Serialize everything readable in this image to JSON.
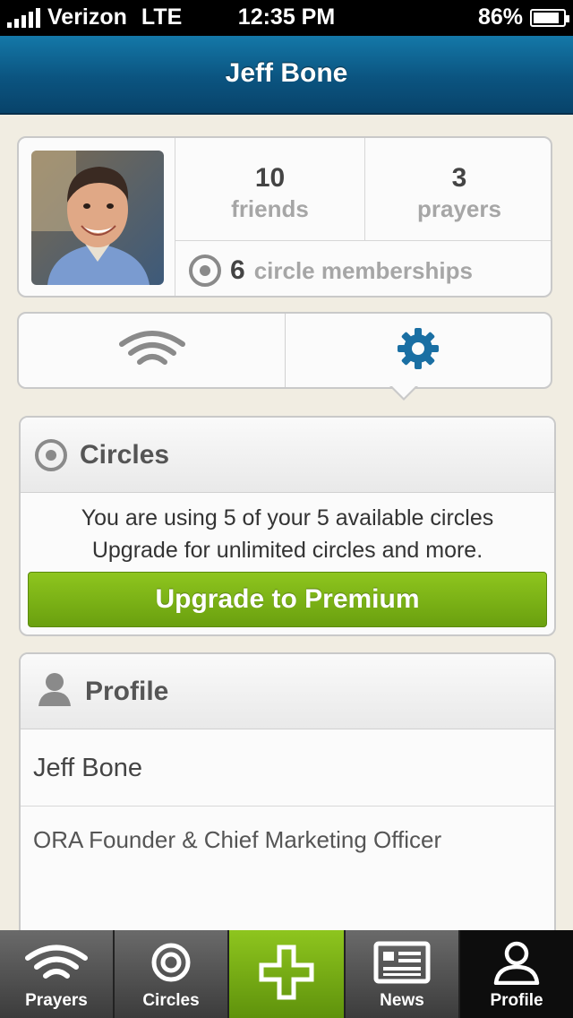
{
  "status_bar": {
    "carrier": "Verizon",
    "network": "LTE",
    "time": "12:35 PM",
    "battery": "86%"
  },
  "nav": {
    "title": "Jeff Bone"
  },
  "stats": {
    "friends_count": "10",
    "friends_label": "friends",
    "prayers_count": "3",
    "prayers_label": "prayers",
    "memberships_count": "6",
    "memberships_label": "circle memberships"
  },
  "segment": {
    "left_icon": "wifi-icon",
    "right_icon": "gear-icon",
    "selected": "settings"
  },
  "circles_panel": {
    "title": "Circles",
    "line1": "You are using 5 of your 5 available circles",
    "line2": "Upgrade for unlimited circles and more.",
    "button": "Upgrade to Premium"
  },
  "profile_panel": {
    "title": "Profile",
    "name": "Jeff Bone",
    "job_title": "ORA Founder & Chief Marketing Officer"
  },
  "tabbar": {
    "items": [
      {
        "label": "Prayers",
        "icon": "wifi-icon"
      },
      {
        "label": "Circles",
        "icon": "target-icon"
      },
      {
        "label": "",
        "icon": "plus-icon"
      },
      {
        "label": "News",
        "icon": "newspaper-icon"
      },
      {
        "label": "Profile",
        "icon": "person-icon"
      }
    ]
  },
  "colors": {
    "nav_blue": "#0b5480",
    "accent_green": "#7bb315",
    "gear_blue": "#1a6fa3"
  }
}
